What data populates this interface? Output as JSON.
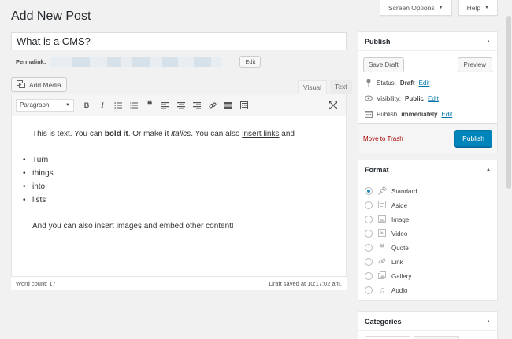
{
  "page": {
    "title": "Add New Post"
  },
  "screen_meta": {
    "screen_options": "Screen Options",
    "help": "Help"
  },
  "post": {
    "title": "What is a CMS?",
    "permalink_label": "Permalink:",
    "permalink_edit": "Edit"
  },
  "editor": {
    "add_media": "Add Media",
    "tabs": {
      "visual": "Visual",
      "text": "Text"
    },
    "format_select": "Paragraph",
    "toolbar_icons": [
      "bold-icon",
      "italic-icon",
      "bullet-list-icon",
      "numbered-list-icon",
      "blockquote-icon",
      "align-left-icon",
      "align-center-icon",
      "align-right-icon",
      "link-icon",
      "read-more-icon",
      "toolbar-toggle-icon",
      "fullscreen-icon"
    ],
    "content": {
      "p1_a": "This is text. You can ",
      "p1_bold": "bold it",
      "p1_b": ". Or make it ",
      "p1_italic": "italics",
      "p1_c": ". You can also ",
      "p1_link": "insert links",
      "p1_d": " and",
      "list": [
        "Turn",
        "things",
        "into",
        "lists"
      ],
      "p2": "And you can also insert images and embed other content!"
    },
    "word_count": "Word count: 17",
    "draft_saved": "Draft saved at 10:17:02 am."
  },
  "publish": {
    "heading": "Publish",
    "save_draft": "Save Draft",
    "preview": "Preview",
    "status_label": "Status: ",
    "status_value": "Draft",
    "visibility_label": "Visibility: ",
    "visibility_value": "Public",
    "publish_label": "Publish ",
    "publish_value": "immediately",
    "edit": "Edit",
    "move_to_trash": "Move to Trash",
    "publish_button": "Publish"
  },
  "format": {
    "heading": "Format",
    "selected": "Standard",
    "items": [
      "Standard",
      "Aside",
      "Image",
      "Video",
      "Quote",
      "Link",
      "Gallery",
      "Audio"
    ]
  },
  "categories": {
    "heading": "Categories"
  },
  "colors": {
    "primary": "#0085ba",
    "link": "#0073aa",
    "trash": "#a00000",
    "background": "#f1f1f1"
  }
}
